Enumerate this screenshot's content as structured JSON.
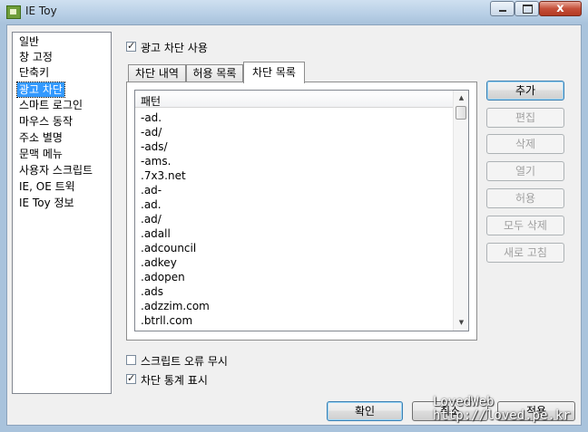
{
  "window": {
    "title": "IE Toy",
    "close_glyph": "x"
  },
  "nav": {
    "items": [
      {
        "label": "일반",
        "selected": false
      },
      {
        "label": "창 고정",
        "selected": false
      },
      {
        "label": "단축키",
        "selected": false
      },
      {
        "label": "광고 차단",
        "selected": true
      },
      {
        "label": "스마트 로그인",
        "selected": false
      },
      {
        "label": "마우스 동작",
        "selected": false
      },
      {
        "label": "주소 별명",
        "selected": false
      },
      {
        "label": "문맥 메뉴",
        "selected": false
      },
      {
        "label": "사용자 스크립트",
        "selected": false
      },
      {
        "label": "IE, OE 트윅",
        "selected": false
      },
      {
        "label": "IE Toy 정보",
        "selected": false
      }
    ]
  },
  "adblock_enable": {
    "label": "광고 차단 사용",
    "checked": true
  },
  "tabs": [
    {
      "label": "차단 내역",
      "active": false
    },
    {
      "label": "허용 목록",
      "active": false
    },
    {
      "label": "차단 목록",
      "active": true
    }
  ],
  "list": {
    "header": "패턴",
    "rows": [
      "-ad.",
      "-ad/",
      "-ads/",
      "-ams.",
      ".7x3.net",
      ".ad-",
      ".ad.",
      ".ad/",
      ".adall",
      ".adcouncil",
      ".adkey",
      ".adopen",
      ".ads",
      ".adzzim.com",
      ".btrll.com"
    ],
    "scroll_up_glyph": "▲",
    "scroll_down_glyph": "▼"
  },
  "side_buttons": [
    {
      "label": "추가",
      "enabled": true
    },
    {
      "label": "편집",
      "enabled": false
    },
    {
      "label": "삭제",
      "enabled": false
    },
    {
      "label": "열기",
      "enabled": false
    },
    {
      "label": "허용",
      "enabled": false
    },
    {
      "label": "모두 삭제",
      "enabled": false
    },
    {
      "label": "새로 고침",
      "enabled": false
    }
  ],
  "options": {
    "ignore_script_errors": {
      "label": "스크립트 오류 무시",
      "checked": false
    },
    "show_block_stats": {
      "label": "차단 통계 표시",
      "checked": true
    }
  },
  "dialog_buttons": {
    "ok": "확인",
    "cancel": "취소",
    "apply": "적용"
  },
  "watermark": {
    "line1": "LovedWeb",
    "line2": "http://loved.pe.kr"
  }
}
